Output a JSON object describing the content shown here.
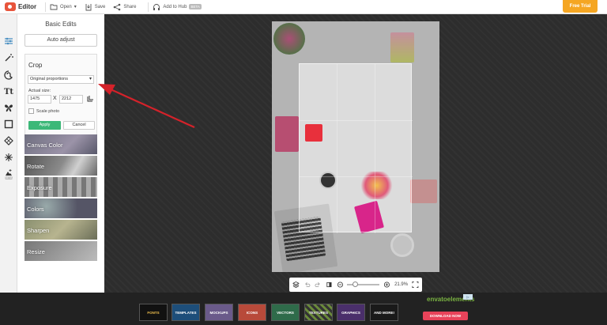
{
  "topbar": {
    "app_name": "Editor",
    "open_label": "Open",
    "save_label": "Save",
    "share_label": "Share",
    "hub_label": "Add to Hub",
    "beta_label": "BETA",
    "free_trial_label": "Free Trial",
    "accent": "#f5a623"
  },
  "tools": [
    {
      "icon": "sliders-icon"
    },
    {
      "icon": "magic-wand-icon"
    },
    {
      "icon": "face-icon"
    },
    {
      "icon": "text-icon",
      "glyph": "Tt"
    },
    {
      "icon": "butterfly-icon"
    },
    {
      "icon": "frame-icon"
    },
    {
      "icon": "texture-icon"
    },
    {
      "icon": "overlay-icon"
    },
    {
      "icon": "add-beta-icon",
      "badge": "BETA"
    }
  ],
  "panel": {
    "title": "Basic Edits",
    "auto_adjust": "Auto adjust",
    "crop": {
      "title": "Crop",
      "proportion": "Original proportions",
      "actual_size_label": "Actual size:",
      "width": "1475",
      "height": "2212",
      "times": "X",
      "scale_label": "Scale photo",
      "apply": "Apply",
      "cancel": "Cancel",
      "apply_color": "#3cb878"
    },
    "tiles": [
      {
        "label": "Canvas Color"
      },
      {
        "label": "Rotate"
      },
      {
        "label": "Exposure"
      },
      {
        "label": "Colors"
      },
      {
        "label": "Sharpen"
      },
      {
        "label": "Resize"
      }
    ]
  },
  "zoom": {
    "value": "21.9%",
    "level": 0.22
  },
  "ad": {
    "thumbs": [
      "FONTS",
      "TEMPLATES",
      "MOCKUPS",
      "ICONS",
      "VECTORS",
      "TEXTURES",
      "GRAPHICS",
      "AND MORE!"
    ],
    "brand": "envatoelements",
    "cta": "DOWNLOAD NOW",
    "choice": "▷"
  }
}
